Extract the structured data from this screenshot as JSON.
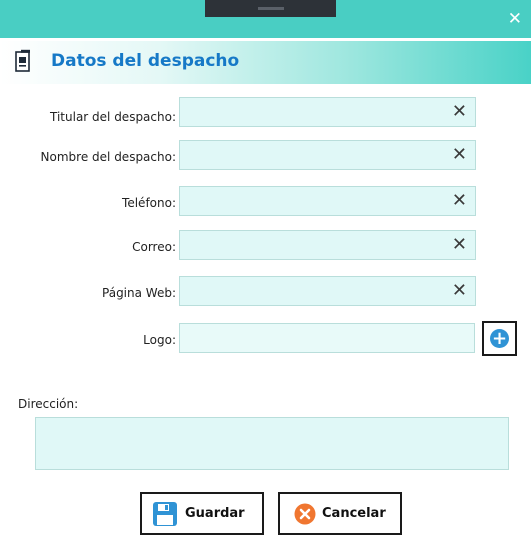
{
  "window": {
    "close_glyph": "✕"
  },
  "header": {
    "title": "Datos del despacho",
    "icon": "document-icon"
  },
  "fields": [
    {
      "label": "Titular del despacho:",
      "value": "",
      "clear_glyph": "✕"
    },
    {
      "label": "Nombre del despacho:",
      "value": "",
      "clear_glyph": "✕"
    },
    {
      "label": "Teléfono:",
      "value": "",
      "clear_glyph": "✕"
    },
    {
      "label": "Correo:",
      "value": "",
      "clear_glyph": "✕"
    },
    {
      "label": "Página Web:",
      "value": "",
      "clear_glyph": "✕"
    }
  ],
  "logo": {
    "label": "Logo:",
    "value": "",
    "add_glyph": "+"
  },
  "direccion": {
    "label": "Dirección:",
    "value": ""
  },
  "buttons": {
    "save": "Guardar",
    "cancel": "Cancelar"
  },
  "colors": {
    "titlebar": "#49cec3",
    "field_bg": "#e0f8f7",
    "title_text": "#1679c7",
    "add_icon": "#2f93d5",
    "cancel_icon": "#f07630",
    "save_icon": "#2f93d5"
  }
}
